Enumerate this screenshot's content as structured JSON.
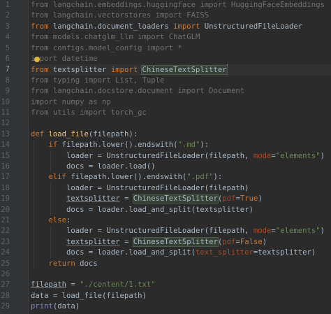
{
  "editor": {
    "current_line": 7,
    "lines": [
      {
        "n": "1",
        "segs": [
          [
            "dim",
            "from langchain.embeddings.huggingface import HuggingFaceEmbeddings"
          ]
        ]
      },
      {
        "n": "2",
        "segs": [
          [
            "dim",
            "from langchain.vectorstores import FAISS"
          ]
        ]
      },
      {
        "n": "3",
        "segs": [
          [
            "kw",
            "from "
          ],
          [
            "t",
            "langchain.document_loaders "
          ],
          [
            "kw",
            "import "
          ],
          [
            "t",
            "UnstructuredFileLoader"
          ]
        ]
      },
      {
        "n": "4",
        "segs": [
          [
            "dim",
            "from models.chatglm_llm import ChatGLM"
          ]
        ]
      },
      {
        "n": "5",
        "segs": [
          [
            "dim",
            "from configs.model_config import *"
          ]
        ]
      },
      {
        "n": "6",
        "segs": [
          [
            "dim",
            "import datetime"
          ]
        ]
      },
      {
        "n": "7",
        "segs": [
          [
            "kw",
            "from "
          ],
          [
            "t",
            "textsplitter "
          ],
          [
            "kw",
            "import "
          ],
          [
            "hl",
            "ChineseTextSplitter"
          ]
        ]
      },
      {
        "n": "8",
        "segs": [
          [
            "dim",
            "from typing import List, Tuple"
          ]
        ]
      },
      {
        "n": "9",
        "segs": [
          [
            "dim",
            "from langchain.docstore.document import Document"
          ]
        ]
      },
      {
        "n": "10",
        "segs": [
          [
            "dim",
            "import numpy as np"
          ]
        ]
      },
      {
        "n": "11",
        "segs": [
          [
            "dim",
            "from utils import torch_gc"
          ]
        ]
      },
      {
        "n": "12",
        "segs": []
      },
      {
        "n": "13",
        "segs": [
          [
            "kw",
            "def "
          ],
          [
            "fn",
            "load_file"
          ],
          [
            "t",
            "(filepath):"
          ]
        ]
      },
      {
        "n": "14",
        "segs": [
          [
            "t",
            "    "
          ],
          [
            "kw",
            "if "
          ],
          [
            "t",
            "filepath.lower().endswith("
          ],
          [
            "str",
            "\".md\""
          ],
          [
            "t",
            "):"
          ]
        ]
      },
      {
        "n": "15",
        "segs": [
          [
            "t",
            "        loader = UnstructuredFileLoader(filepath, "
          ],
          [
            "param",
            "mode"
          ],
          [
            "t",
            "="
          ],
          [
            "str",
            "\"elements\""
          ],
          [
            "t",
            ")"
          ]
        ]
      },
      {
        "n": "16",
        "segs": [
          [
            "t",
            "        docs = loader.load()"
          ]
        ]
      },
      {
        "n": "17",
        "segs": [
          [
            "t",
            "    "
          ],
          [
            "kw",
            "elif "
          ],
          [
            "t",
            "filepath.lower().endswith("
          ],
          [
            "str",
            "\".pdf\""
          ],
          [
            "t",
            "):"
          ]
        ]
      },
      {
        "n": "18",
        "segs": [
          [
            "t",
            "        loader = UnstructuredFileLoader(filepath)"
          ]
        ]
      },
      {
        "n": "19",
        "segs": [
          [
            "t",
            "        "
          ],
          [
            "ul",
            "textsplitter"
          ],
          [
            "t",
            " = "
          ],
          [
            "hl",
            "ChineseTextSplitter"
          ],
          [
            "t",
            "("
          ],
          [
            "param",
            "pdf"
          ],
          [
            "t",
            "="
          ],
          [
            "kw",
            "True"
          ],
          [
            "t",
            ")"
          ]
        ]
      },
      {
        "n": "20",
        "segs": [
          [
            "t",
            "        docs = loader.load_and_split(textsplitter)"
          ]
        ]
      },
      {
        "n": "21",
        "segs": [
          [
            "t",
            "    "
          ],
          [
            "kw",
            "else"
          ],
          [
            "t",
            ":"
          ]
        ]
      },
      {
        "n": "22",
        "segs": [
          [
            "t",
            "        loader = UnstructuredFileLoader(filepath, "
          ],
          [
            "param",
            "mode"
          ],
          [
            "t",
            "="
          ],
          [
            "str",
            "\"elements\""
          ],
          [
            "t",
            ")"
          ]
        ]
      },
      {
        "n": "23",
        "segs": [
          [
            "t",
            "        "
          ],
          [
            "ul",
            "textsplitter"
          ],
          [
            "t",
            " = "
          ],
          [
            "hl",
            "ChineseTextSplitter"
          ],
          [
            "t",
            "("
          ],
          [
            "param",
            "pdf"
          ],
          [
            "t",
            "="
          ],
          [
            "kw",
            "False"
          ],
          [
            "t",
            ")"
          ]
        ]
      },
      {
        "n": "24",
        "segs": [
          [
            "t",
            "        docs = loader.load_and_split("
          ],
          [
            "param",
            "text_splitter"
          ],
          [
            "t",
            "=textsplitter)"
          ]
        ]
      },
      {
        "n": "25",
        "segs": [
          [
            "t",
            "    "
          ],
          [
            "kw",
            "return "
          ],
          [
            "t",
            "docs"
          ]
        ]
      },
      {
        "n": "26",
        "segs": []
      },
      {
        "n": "27",
        "segs": [
          [
            "ul",
            "filepath"
          ],
          [
            "t",
            " = "
          ],
          [
            "str",
            "\"./content/1.txt\""
          ]
        ]
      },
      {
        "n": "28",
        "segs": [
          [
            "t",
            "data = load_file(filepath)"
          ]
        ]
      },
      {
        "n": "29",
        "segs": [
          [
            "builtin",
            "print"
          ],
          [
            "t",
            "(data)"
          ]
        ]
      }
    ]
  }
}
